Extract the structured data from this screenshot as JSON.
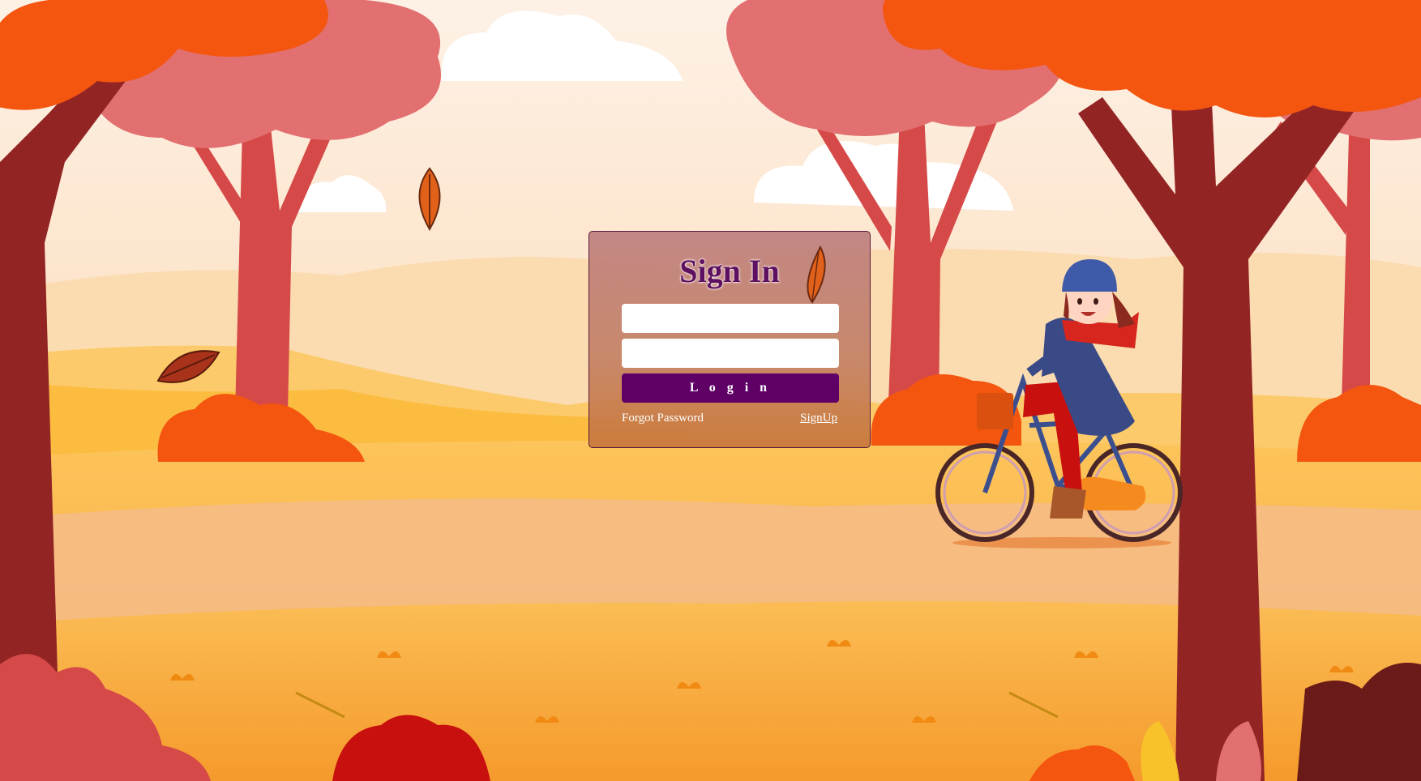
{
  "login": {
    "title": "Sign In",
    "username_placeholder": "",
    "password_placeholder": "",
    "login_button": "L o g i n",
    "forgot_password": "Forgot Password",
    "signup": "SignUp"
  },
  "colors": {
    "accent": "#5e0066",
    "title": "#5e1060",
    "sky": "#fdeede",
    "ground": "#f9b53c"
  },
  "illustration": {
    "scene": "autumn-park",
    "icons": [
      "tree-icon",
      "bush-icon",
      "leaf-icon",
      "cloud-icon",
      "cyclist-icon",
      "bicycle-icon"
    ]
  }
}
